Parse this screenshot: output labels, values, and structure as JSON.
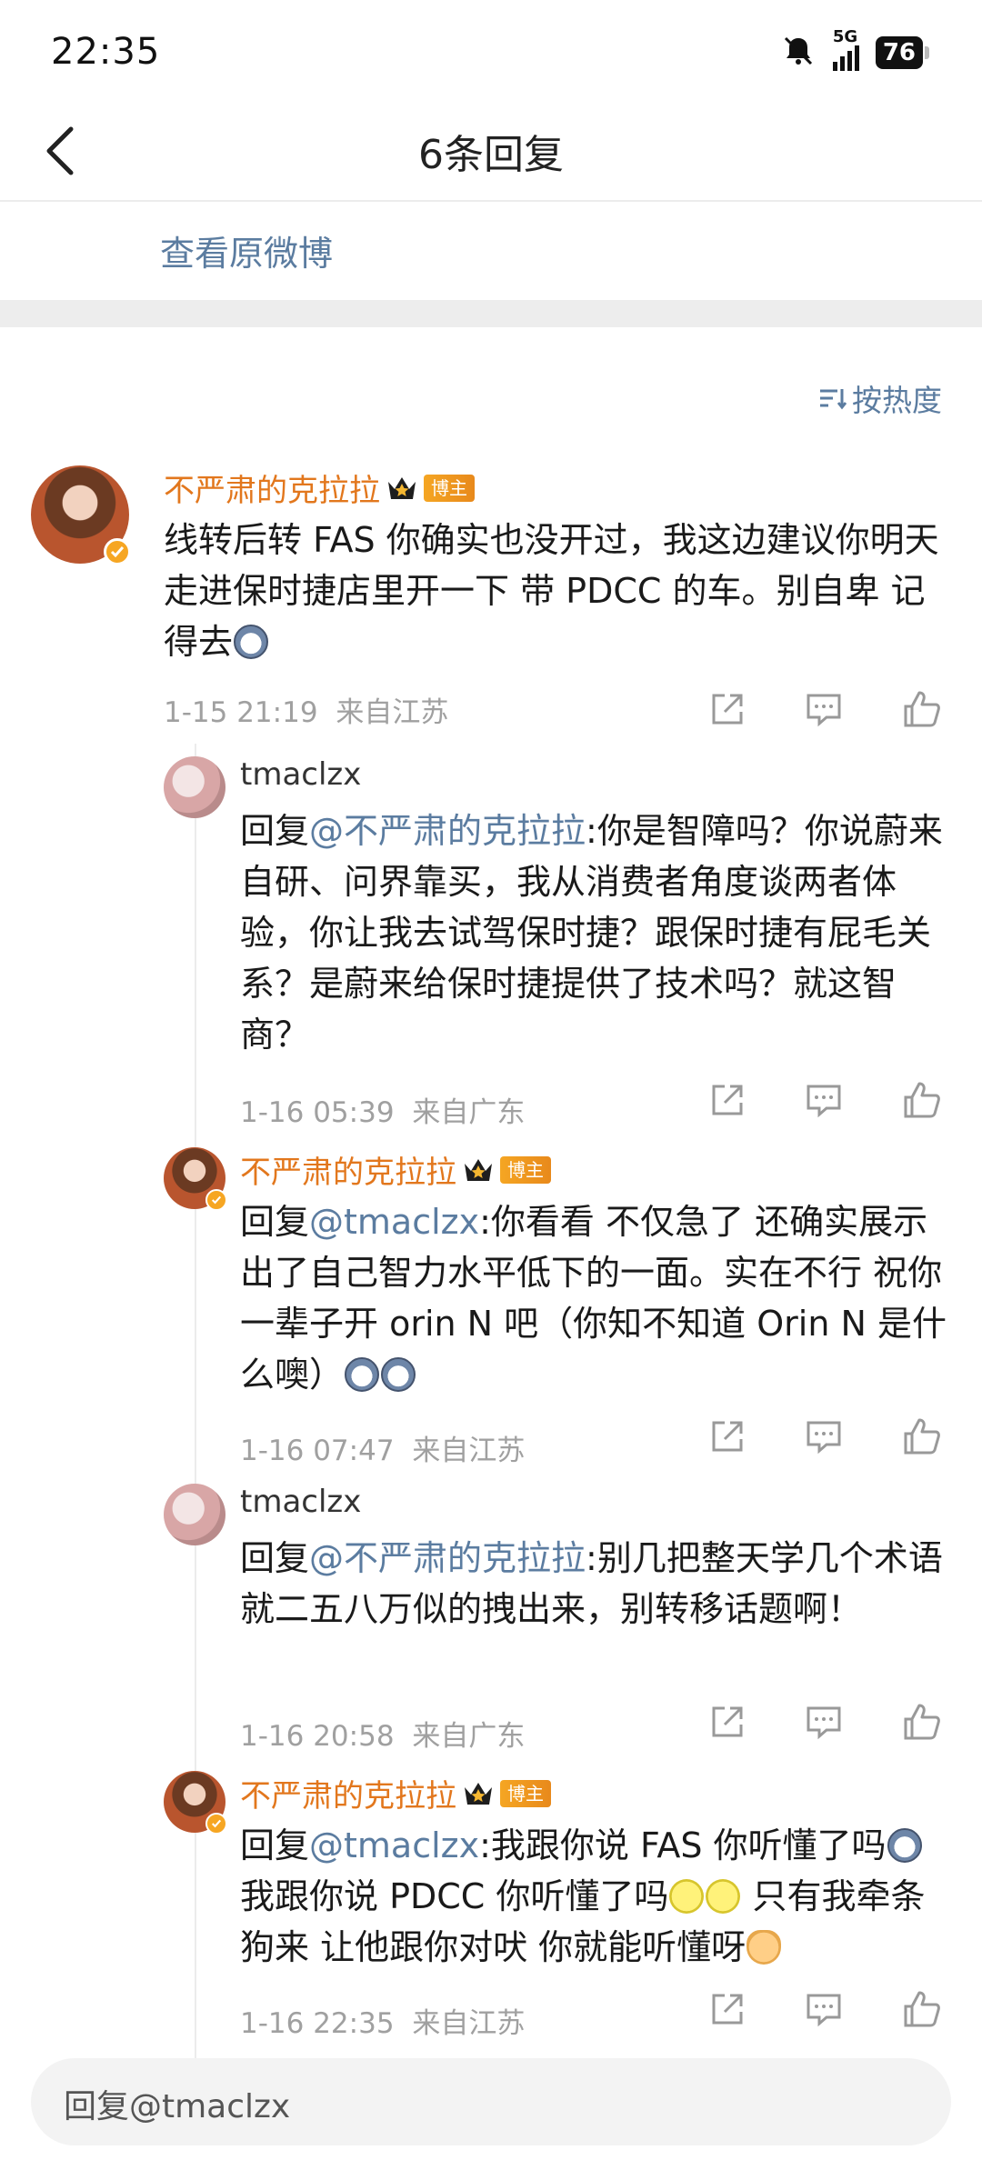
{
  "status_bar": {
    "time": "22:35",
    "network": "5G",
    "battery": "76"
  },
  "nav": {
    "title": "6条回复"
  },
  "view_original": "查看原微博",
  "sort_label": "按热度",
  "colors": {
    "accent": "#5b7ca0",
    "owner_name": "#e2771d",
    "meta_gray": "#a0a0a0"
  },
  "main_comment": {
    "username": "不严肃的克拉拉",
    "badge": "博主",
    "text": "线转后转 FAS 你确实也没开过，我这边建议你明天走进保时捷店里开一下 带 PDCC 的车。别自卑 记得去",
    "time": "1-15 21:19",
    "location": "来自江苏"
  },
  "replies": [
    {
      "username": "tmaclzx",
      "prefix": "回复",
      "mention": "@不严肃的克拉拉",
      "text": ":你是智障吗？你说蔚来自研、问界靠买，我从消费者角度谈两者体验，你让我去试驾保时捷？跟保时捷有屁毛关系？是蔚来给保时捷提供了技术吗？就这智商？",
      "time": "1-16 05:39",
      "location": "来自广东"
    },
    {
      "username": "不严肃的克拉拉",
      "badge": "博主",
      "prefix": "回复",
      "mention": "@tmaclzx",
      "text": ":你看看 不仅急了 还确实展示出了自己智力水平低下的一面。实在不行 祝你一辈子开 orin N 吧（你知不知道 Orin N 是什么噢）",
      "time": "1-16 07:47",
      "location": "来自江苏"
    },
    {
      "username": "tmaclzx",
      "prefix": "回复",
      "mention": "@不严肃的克拉拉",
      "text": ":别几把整天学几个术语就二五八万似的拽出来，别转移话题啊！",
      "time": "1-16 20:58",
      "location": "来自广东"
    },
    {
      "username": "不严肃的克拉拉",
      "badge": "博主",
      "prefix": "回复",
      "mention": "@tmaclzx",
      "text_a": ":我跟你说 FAS 你听懂了吗",
      "text_b": " 我跟你说 PDCC 你听懂了吗",
      "text_c": " 只有我牵条狗来 让他跟你对吠 你就能听懂呀",
      "time": "1-16 22:35",
      "location": "来自江苏"
    }
  ],
  "reply_input": {
    "placeholder": "回复@tmaclzx"
  }
}
